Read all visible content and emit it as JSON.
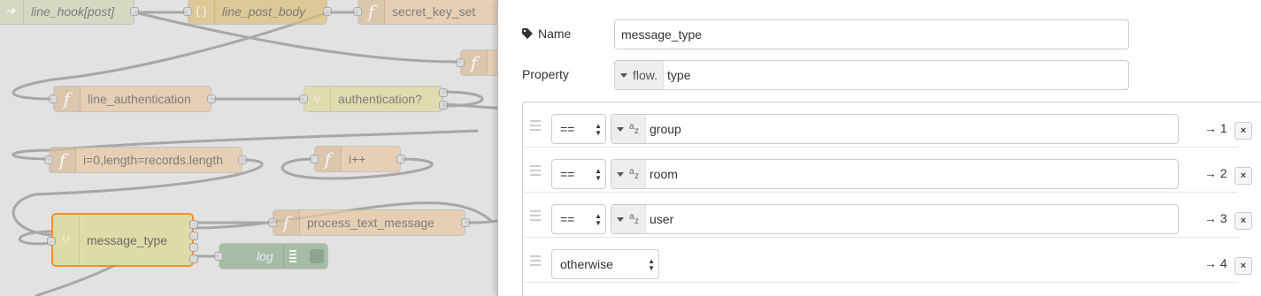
{
  "flow": {
    "nodes": {
      "line_hook": "line_hook[post]",
      "line_post_body": "line_post_body",
      "secret_key_set": "secret_key_set",
      "line_authentication": "line_authentication",
      "authentication": "authentication?",
      "loop_init": "i=0,length=records.length",
      "increment": "i++",
      "message_type": "message_type",
      "process_text_message": "process_text_message",
      "log": "log"
    },
    "colors": {
      "function": "#e9c9a5",
      "switch": "#dedb9c",
      "http": "#d3d5b5",
      "template": "#dcc07a",
      "debug": "#8fae8d",
      "selected_border": "#ff7f0e"
    }
  },
  "editor": {
    "name_label": "Name",
    "name_value": "message_type",
    "property_label": "Property",
    "property_type": "flow.",
    "property_value": "type",
    "rules": [
      {
        "operator": "==",
        "type_icon": "az-string-icon",
        "value": "group",
        "output": "→ 1"
      },
      {
        "operator": "==",
        "type_icon": "az-string-icon",
        "value": "room",
        "output": "→ 2"
      },
      {
        "operator": "==",
        "type_icon": "az-string-icon",
        "value": "user",
        "output": "→ 3"
      },
      {
        "operator": "otherwise",
        "output": "→ 4"
      }
    ],
    "delete_label": "×"
  }
}
